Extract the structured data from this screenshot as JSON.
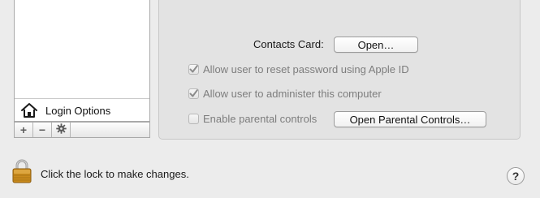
{
  "sidebar": {
    "login_options_label": "Login Options",
    "toolbar": {
      "add": "+",
      "remove": "−",
      "action": "⚙"
    }
  },
  "panel": {
    "contacts_card_label": "Contacts Card:",
    "open_button_label": "Open…",
    "options": [
      {
        "label": "Allow user to reset password using Apple ID",
        "checked": true,
        "enabled": false
      },
      {
        "label": "Allow user to administer this computer",
        "checked": true,
        "enabled": false
      },
      {
        "label": "Enable parental controls",
        "checked": false,
        "enabled": false
      }
    ],
    "open_parental_controls_label": "Open Parental Controls…"
  },
  "footer": {
    "lock_text": "Click the lock to make changes.",
    "help_label": "?"
  },
  "icons": {
    "lock": "lock-icon",
    "home": "house-icon",
    "gear": "gear-icon",
    "help": "help-icon"
  },
  "colors": {
    "lock_gold": "#c98a1c",
    "panel_bg": "#e3e3e3",
    "window_bg": "#ececec"
  }
}
